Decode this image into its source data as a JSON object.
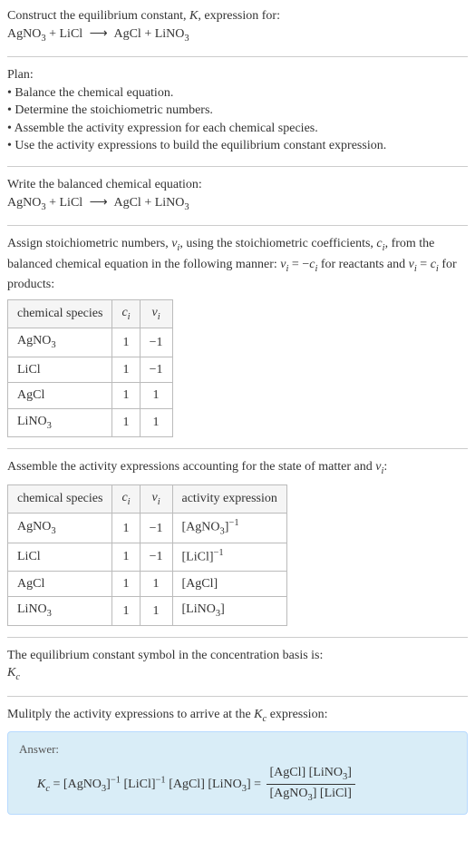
{
  "header": {
    "prompt_line1": "Construct the equilibrium constant, ",
    "prompt_k": "K",
    "prompt_line1b": ", expression for:"
  },
  "equation": {
    "r1": "AgNO",
    "r1_sub": "3",
    "plus": " + ",
    "r2": "LiCl",
    "arrow": "⟶",
    "p1": "AgCl",
    "p2": "LiNO",
    "p2_sub": "3"
  },
  "plan": {
    "title": "Plan:",
    "items": [
      "Balance the chemical equation.",
      "Determine the stoichiometric numbers.",
      "Assemble the activity expression for each chemical species.",
      "Use the activity expressions to build the equilibrium constant expression."
    ]
  },
  "balanced": {
    "title": "Write the balanced chemical equation:"
  },
  "stoich": {
    "intro_a": "Assign stoichiometric numbers, ",
    "nu": "ν",
    "sub_i": "i",
    "intro_b": ", using the stoichiometric coefficients, ",
    "c": "c",
    "intro_c": ", from the balanced chemical equation in the following manner: ",
    "rel1": " = −",
    "intro_d": " for reactants and ",
    "rel2": " = ",
    "intro_e": " for products:"
  },
  "table1": {
    "h1": "chemical species",
    "h2": "c",
    "h2_sub": "i",
    "h3": "ν",
    "h3_sub": "i",
    "rows": [
      {
        "species": "AgNO",
        "species_sub": "3",
        "c": "1",
        "nu": "−1"
      },
      {
        "species": "LiCl",
        "species_sub": "",
        "c": "1",
        "nu": "−1"
      },
      {
        "species": "AgCl",
        "species_sub": "",
        "c": "1",
        "nu": "1"
      },
      {
        "species": "LiNO",
        "species_sub": "3",
        "c": "1",
        "nu": "1"
      }
    ]
  },
  "assemble": {
    "text_a": "Assemble the activity expressions accounting for the state of matter and ",
    "text_b": ":"
  },
  "table2": {
    "h1": "chemical species",
    "h2": "c",
    "h2_sub": "i",
    "h3": "ν",
    "h3_sub": "i",
    "h4": "activity expression",
    "rows": [
      {
        "species": "AgNO",
        "species_sub": "3",
        "c": "1",
        "nu": "−1",
        "act_pre": "[AgNO",
        "act_sub": "3",
        "act_post": "]",
        "act_sup": "−1"
      },
      {
        "species": "LiCl",
        "species_sub": "",
        "c": "1",
        "nu": "−1",
        "act_pre": "[LiCl",
        "act_sub": "",
        "act_post": "]",
        "act_sup": "−1"
      },
      {
        "species": "AgCl",
        "species_sub": "",
        "c": "1",
        "nu": "1",
        "act_pre": "[AgCl",
        "act_sub": "",
        "act_post": "]",
        "act_sup": ""
      },
      {
        "species": "LiNO",
        "species_sub": "3",
        "c": "1",
        "nu": "1",
        "act_pre": "[LiNO",
        "act_sub": "3",
        "act_post": "]",
        "act_sup": ""
      }
    ]
  },
  "kc_basis": {
    "text": "The equilibrium constant symbol in the concentration basis is:",
    "symbol": "K",
    "symbol_sub": "c"
  },
  "multiply": {
    "text_a": "Mulitply the activity expressions to arrive at the ",
    "text_b": " expression:"
  },
  "answer": {
    "label": "Answer:",
    "kc": "K",
    "kc_sub": "c",
    "eq": " = ",
    "t1": "[AgNO",
    "t1_sub": "3",
    "t1_post": "]",
    "t1_sup": "−1",
    "sp": " ",
    "t2": "[LiCl]",
    "t2_sup": "−1",
    "t3": "[AgCl]",
    "t4": "[LiNO",
    "t4_sub": "3",
    "t4_post": "]",
    "eq2": " = ",
    "num_a": "[AgCl] [LiNO",
    "num_sub": "3",
    "num_b": "]",
    "den_a": "[AgNO",
    "den_sub": "3",
    "den_b": "] [LiCl]"
  }
}
